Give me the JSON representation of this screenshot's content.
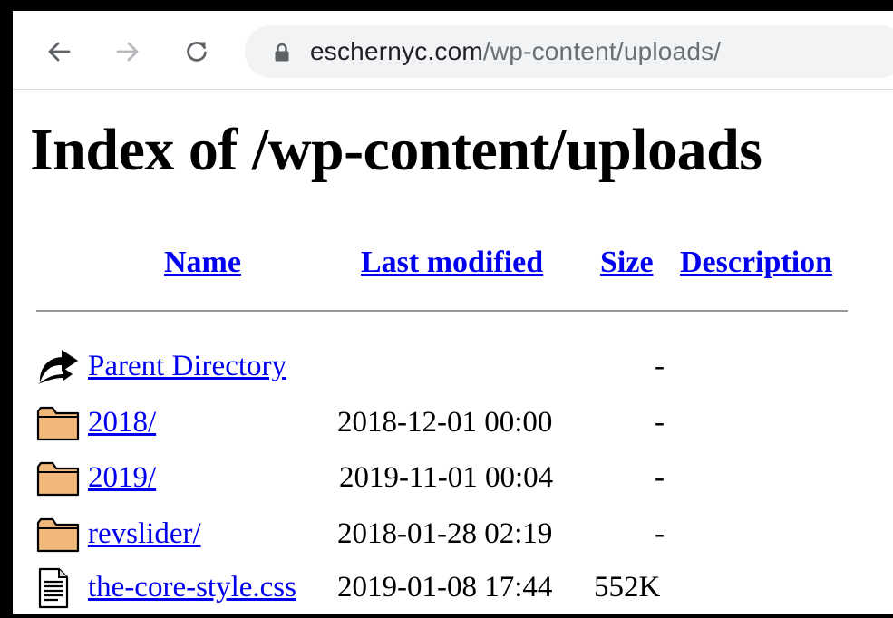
{
  "browser": {
    "url_host": "eschernyc.com",
    "url_path": "/wp-content/uploads/",
    "icons": [
      "back-arrow-icon",
      "forward-arrow-icon",
      "reload-icon",
      "lock-icon"
    ]
  },
  "page": {
    "title": "Index of /wp-content/uploads",
    "columns": {
      "name": "Name",
      "last_modified": "Last modified",
      "size": "Size",
      "description": "Description"
    },
    "rows": [
      {
        "icon": "parent-directory-icon",
        "name": "Parent Directory",
        "modified": "",
        "size": "-"
      },
      {
        "icon": "folder-icon",
        "name": "2018/",
        "modified": "2018-12-01 00:00",
        "size": "-"
      },
      {
        "icon": "folder-icon",
        "name": "2019/",
        "modified": "2019-11-01 00:04",
        "size": "-"
      },
      {
        "icon": "folder-icon",
        "name": "revslider/",
        "modified": "2018-01-28 02:19",
        "size": "-"
      },
      {
        "icon": "text-file-icon",
        "name": "the-core-style.css",
        "modified": "2019-01-08 17:44",
        "size": "552K"
      }
    ]
  }
}
